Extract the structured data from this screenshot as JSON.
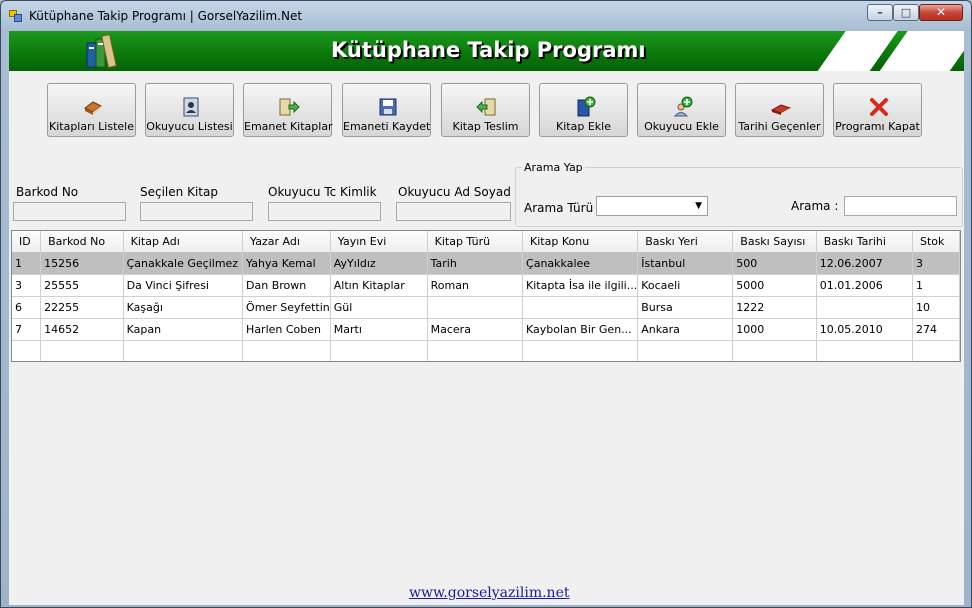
{
  "window": {
    "title": "Kütüphane Takip Programı | GorselYazilim.Net",
    "controls": {
      "minimize": "–",
      "maximize": "□",
      "close": "✕"
    }
  },
  "banner": {
    "title": "Kütüphane Takip Programı"
  },
  "toolbar": [
    {
      "label": "Kitapları Listele",
      "icon": "books-stack-icon"
    },
    {
      "label": "Okuyucu Listesi",
      "icon": "reader-card-icon"
    },
    {
      "label": "Emanet Kitaplar",
      "icon": "book-arrow-icon"
    },
    {
      "label": "Emaneti Kaydet",
      "icon": "save-disk-icon"
    },
    {
      "label": "Kitap Teslim",
      "icon": "return-arrow-icon"
    },
    {
      "label": "Kitap Ekle",
      "icon": "add-book-icon"
    },
    {
      "label": "Okuyucu Ekle",
      "icon": "add-user-icon"
    },
    {
      "label": "Tarihi Geçenler",
      "icon": "overdue-book-icon"
    },
    {
      "label": "Programı Kapat",
      "icon": "close-x-icon"
    }
  ],
  "fields": {
    "barkod_label": "Barkod No",
    "kitap_label": "Seçilen Kitap",
    "tc_label": "Okuyucu Tc Kimlik",
    "adsoyad_label": "Okuyucu Ad Soyad",
    "barkod_value": "",
    "kitap_value": "",
    "tc_value": "",
    "adsoyad_value": ""
  },
  "search": {
    "group_title": "Arama Yap",
    "type_label": "Arama Türü :",
    "type_value": "",
    "query_label": "Arama :",
    "query_value": ""
  },
  "grid": {
    "columns": [
      "ID",
      "Barkod No",
      "Kitap Adı",
      "Yazar Adı",
      "Yayın Evi",
      "Kitap Türü",
      "Kitap Konu",
      "Baskı Yeri",
      "Baskı Sayısı",
      "Baskı Tarihi",
      "Stok"
    ],
    "rows": [
      [
        "1",
        "15256",
        "Çanakkale Geçilmez",
        "Yahya Kemal",
        "AyYıldız",
        "Tarih",
        "Çanakkalee",
        "İstanbul",
        "500",
        "12.06.2007",
        "3"
      ],
      [
        "3",
        "25555",
        "Da Vinci Şifresi",
        "Dan Brown",
        "Altın Kitaplar",
        "Roman",
        "Kitapta İsa ile ilgili...",
        "Kocaeli",
        "5000",
        "01.01.2006",
        "1"
      ],
      [
        "6",
        "22255",
        "Kaşağı",
        "Ömer Seyfettin",
        "Gül",
        "",
        "",
        "Bursa",
        "1222",
        "",
        "10"
      ],
      [
        "7",
        "14652",
        "Kapan",
        "Harlen Coben",
        "Martı",
        "Macera",
        "Kaybolan Bir Gen...",
        "Ankara",
        "1000",
        "10.05.2010",
        "274"
      ],
      [
        "",
        "",
        "",
        "",
        "",
        "",
        "",
        "",
        "",
        "",
        ""
      ]
    ],
    "selected_row": 0
  },
  "footer": {
    "link": "www.gorselyazilim.net"
  },
  "colors": {
    "banner_green": "#0b7a0b",
    "selection_gray": "#bfbfbf",
    "link_blue": "#1a1aa0"
  }
}
